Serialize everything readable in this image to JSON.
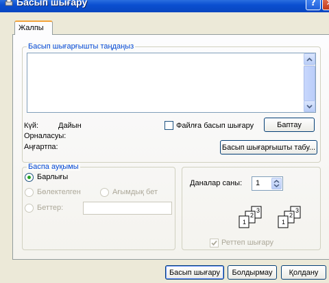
{
  "window": {
    "title": "Басып шығару"
  },
  "tabs": [
    {
      "label": "Жалпы"
    }
  ],
  "printer_group": {
    "label": "Басып шығарғышты таңдаңыз",
    "status_label": "Күй:",
    "status_value": "Дайын",
    "location_label": "Орналасуы:",
    "location_value": "",
    "comment_label": "Аңғартпа:",
    "comment_value": "",
    "print_to_file_label": "Файлға басып шығару",
    "preferences_button": "Баптау",
    "find_printer_button": "Басып шығарғышты табу..."
  },
  "range_group": {
    "label": "Баспа ауқымы",
    "all_label": "Барлығы",
    "selection_label": "Бөлектелген",
    "current_page_label": "Ағымдық бет",
    "pages_label": "Беттер:",
    "pages_value": "",
    "selected": "all"
  },
  "copies": {
    "label": "Даналар саны:",
    "value": "1",
    "collate_label": "Реттеп шығару",
    "collate_checked": true,
    "collate_stack_1": [
      "1",
      "2",
      "3"
    ],
    "collate_stack_2": [
      "1",
      "2",
      "3"
    ]
  },
  "footer": {
    "print_button": "Басып шығару",
    "cancel_button": "Болдырмау",
    "apply_button": "Қолдану"
  },
  "colors": {
    "titlebar": "#0a4fd0",
    "dialog_bg": "#ece9d8",
    "group_label": "#0046d5",
    "tab_highlight": "#f3a33a",
    "disabled_text": "#aca899"
  }
}
